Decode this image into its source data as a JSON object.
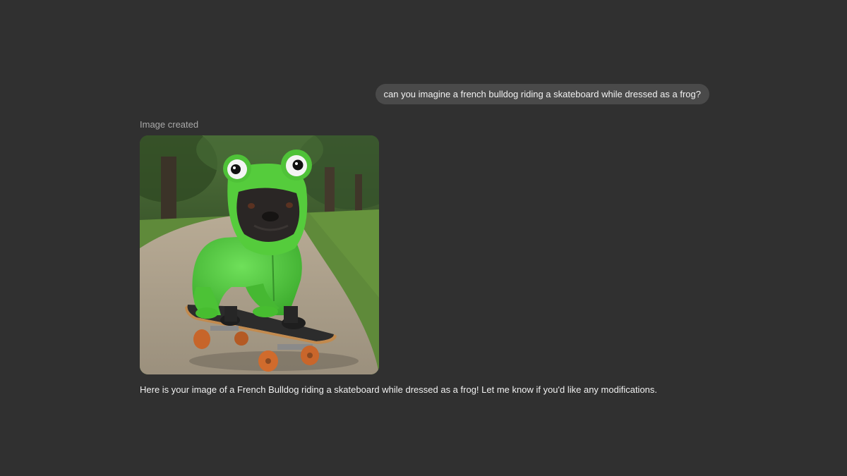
{
  "conversation": {
    "user_message": "can you imagine a french bulldog riding a skateboard while dressed as a frog?",
    "status_label": "Image created",
    "assistant_reply": "Here is your image of a French Bulldog riding a skateboard while dressed as a frog! Let me know if you'd like any modifications."
  },
  "colors": {
    "background": "#303030",
    "user_bubble": "#4a4a4a",
    "status_text": "#a9a9a9"
  }
}
